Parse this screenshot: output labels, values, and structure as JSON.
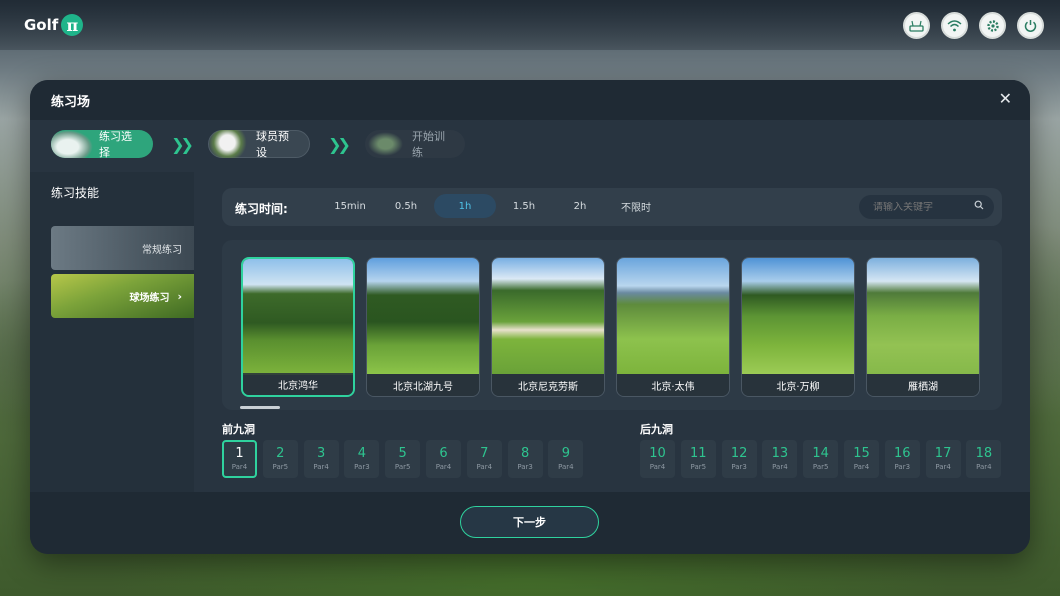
{
  "app": {
    "logo_text": "Golf",
    "logo_mark": "π"
  },
  "top_icons": [
    "router-icon",
    "wifi-icon",
    "settings-icon",
    "power-icon"
  ],
  "dialog": {
    "title": "练习场",
    "close_glyph": "✕"
  },
  "steps": [
    {
      "label": "练习选择",
      "state": "active"
    },
    {
      "label": "球员预设",
      "state": "pending"
    },
    {
      "label": "开始训练",
      "state": "disabled"
    }
  ],
  "sidebar": {
    "title": "练习技能",
    "items": [
      {
        "label": "常规练习",
        "selected": false
      },
      {
        "label": "球场练习",
        "selected": true
      }
    ]
  },
  "practice_time": {
    "label": "练习时间:",
    "options": [
      "15min",
      "0.5h",
      "1h",
      "1.5h",
      "2h",
      "不限时"
    ],
    "selected": "1h"
  },
  "search": {
    "placeholder": "请输入关键字"
  },
  "courses": [
    {
      "name": "北京鸿华",
      "selected": true
    },
    {
      "name": "北京北湖九号",
      "selected": false
    },
    {
      "name": "北京尼克劳斯",
      "selected": false
    },
    {
      "name": "北京·太伟",
      "selected": false
    },
    {
      "name": "北京·万柳",
      "selected": false
    },
    {
      "name": "雁栖湖",
      "selected": false
    }
  ],
  "front_nine": {
    "label": "前九洞",
    "holes": [
      {
        "n": "1",
        "par": "Par4"
      },
      {
        "n": "2",
        "par": "Par5"
      },
      {
        "n": "3",
        "par": "Par4"
      },
      {
        "n": "4",
        "par": "Par3"
      },
      {
        "n": "5",
        "par": "Par5"
      },
      {
        "n": "6",
        "par": "Par4"
      },
      {
        "n": "7",
        "par": "Par4"
      },
      {
        "n": "8",
        "par": "Par3"
      },
      {
        "n": "9",
        "par": "Par4"
      }
    ],
    "selected": "1"
  },
  "back_nine": {
    "label": "后九洞",
    "holes": [
      {
        "n": "10",
        "par": "Par4"
      },
      {
        "n": "11",
        "par": "Par5"
      },
      {
        "n": "12",
        "par": "Par3"
      },
      {
        "n": "13",
        "par": "Par4"
      },
      {
        "n": "14",
        "par": "Par5"
      },
      {
        "n": "15",
        "par": "Par4"
      },
      {
        "n": "16",
        "par": "Par3"
      },
      {
        "n": "17",
        "par": "Par4"
      },
      {
        "n": "18",
        "par": "Par4"
      }
    ]
  },
  "next_button": "下一步",
  "colors": {
    "accent": "#2fd29e",
    "time_selected": "#4fc3e8"
  }
}
